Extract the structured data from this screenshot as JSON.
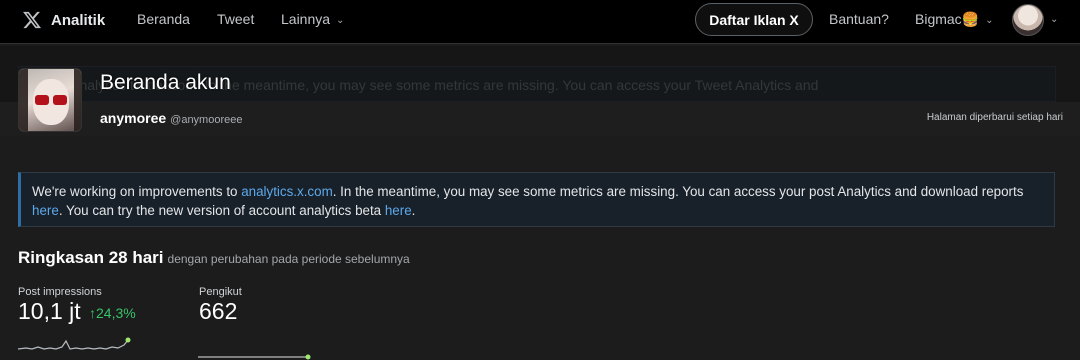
{
  "nav": {
    "brand": "Analitik",
    "links": [
      "Beranda",
      "Tweet",
      "Lainnya"
    ],
    "ads_button": "Daftar Iklan X",
    "help": "Bantuan?",
    "user": "Bigmac🍔"
  },
  "header": {
    "title": "Beranda akun",
    "username": "anymoree",
    "handle": "@anymooreee",
    "updated": "Halaman diperbarui setiap hari",
    "bg_text": "...ork... analytics.twitter.com. In the meantime, you may see some metrics are missing. You can access your Tweet Analytics and"
  },
  "banner": {
    "text1": "We're working on improvements to ",
    "link1": "analytics.x.com",
    "text2": ". In the meantime, you may see some metrics are missing. You can access your post Analytics and download reports ",
    "link2": "here",
    "text3": ". You can try the new version of account analytics beta ",
    "link3": "here",
    "text4": "."
  },
  "summary": {
    "title": "Ringkasan 28 hari",
    "subtitle": "dengan perubahan pada periode sebelumnya",
    "metrics": [
      {
        "label": "Post impressions",
        "value": "10,1 jt",
        "change": "24,3%",
        "direction": "up"
      },
      {
        "label": "Pengikut",
        "value": "662"
      }
    ]
  },
  "colors": {
    "accent_link": "#5ea9eb",
    "positive": "#36c46a",
    "banner_border": "#2f6ea3"
  },
  "icons": [
    "x-logo-icon",
    "chevron-down-icon",
    "arrow-up-icon",
    "avatar"
  ]
}
